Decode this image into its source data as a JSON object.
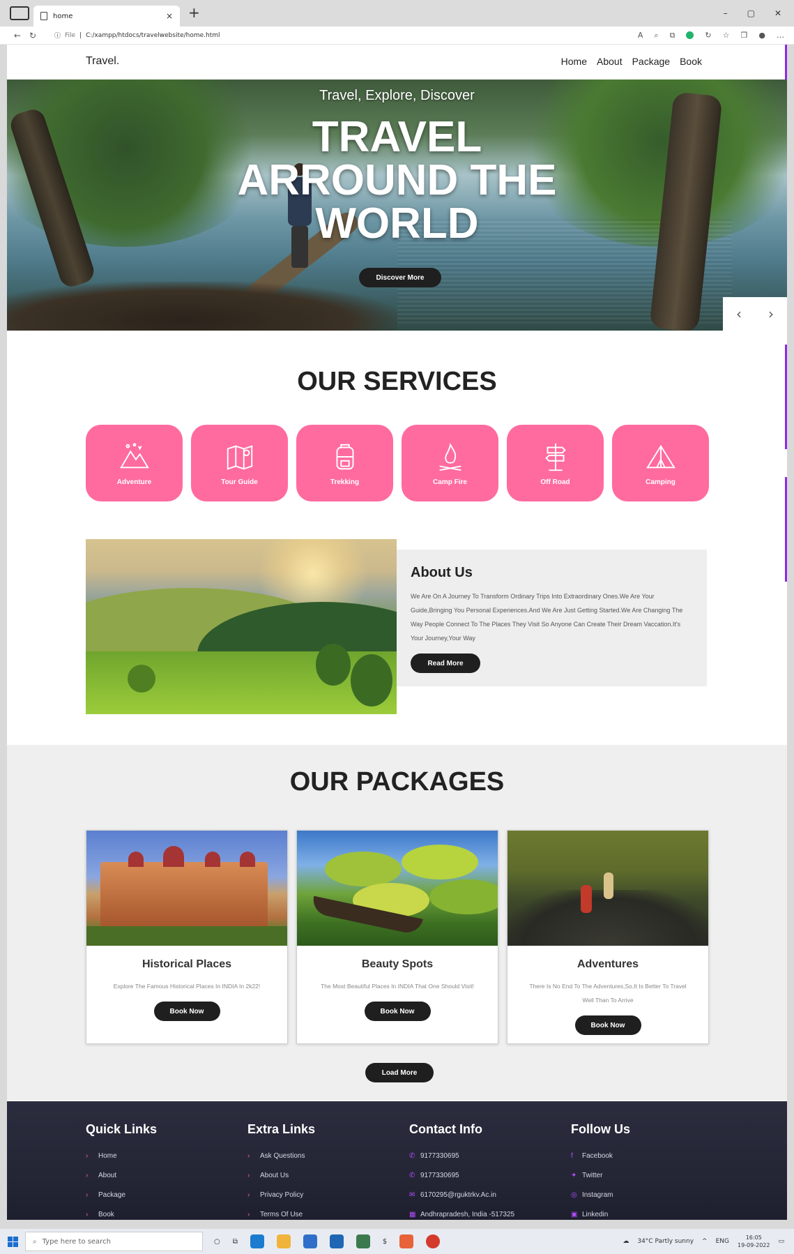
{
  "browser": {
    "tab_title": "home",
    "url_prefix": "File",
    "url": "C:/xampp/htdocs/travelwebsite/home.html",
    "window_controls": [
      "–",
      "▢",
      "✕"
    ]
  },
  "site": {
    "logo": "Travel.",
    "nav": [
      "Home",
      "About",
      "Package",
      "Book"
    ]
  },
  "hero": {
    "tagline": "Travel, Explore, Discover",
    "title_lines": [
      "TRAVEL",
      "ARROUND THE",
      "WORLD"
    ],
    "cta": "Discover More",
    "prev": "‹",
    "next": "›"
  },
  "services": {
    "title": "OUR SERVICES",
    "items": [
      {
        "label": "Adventure",
        "icon": "mountains-icon"
      },
      {
        "label": "Tour Guide",
        "icon": "map-icon"
      },
      {
        "label": "Trekking",
        "icon": "backpack-icon"
      },
      {
        "label": "Camp Fire",
        "icon": "campfire-icon"
      },
      {
        "label": "Off Road",
        "icon": "signpost-icon"
      },
      {
        "label": "Camping",
        "icon": "tent-icon"
      }
    ],
    "accent_color": "#ff6b9e"
  },
  "about": {
    "heading": "About Us",
    "text": "We Are On A Journey To Transform Ordinary Trips Into Extraordinary Ones.We Are Your Guide,Bringing You Personal Experiences.And We Are Just Getting Started.We Are Changing The Way People Connect To The Places They Visit So Anyone Can Create Their Dream Vaccation.It's Your Journey,Your Way",
    "button": "Read More"
  },
  "packages": {
    "title": "OUR PACKAGES",
    "cards": [
      {
        "title": "Historical Places",
        "text": "Explore The Famous Historical Places In INDIA In 2k22!",
        "button": "Book Now"
      },
      {
        "title": "Beauty Spots",
        "text": "The Most Beautiful Places In INDIA That One Should Visit!",
        "button": "Book Now"
      },
      {
        "title": "Adventures",
        "text": "There Is No End To The Adventures,So,It Is Better To Travel Well Than To Arrive",
        "button": "Book Now"
      }
    ],
    "load_more": "Load More"
  },
  "footer": {
    "quick_links": {
      "heading": "Quick Links",
      "items": [
        "Home",
        "About",
        "Package",
        "Book"
      ]
    },
    "extra_links": {
      "heading": "Extra Links",
      "items": [
        "Ask Questions",
        "About Us",
        "Privacy Policy",
        "Terms Of Use"
      ]
    },
    "contact": {
      "heading": "Contact Info",
      "items": [
        "9177330695",
        "9177330695",
        "6170295@rguktrkv.Ac.in",
        "Andhrapradesh, India -517325"
      ]
    },
    "follow": {
      "heading": "Follow Us",
      "items": [
        "Facebook",
        "Twitter",
        "Instagram",
        "Linkedin"
      ]
    }
  },
  "taskbar": {
    "search_placeholder": "Type here to search",
    "weather": "34°C Partly sunny",
    "lang": "ENG",
    "time": "16:05",
    "date": "19-09-2022"
  }
}
